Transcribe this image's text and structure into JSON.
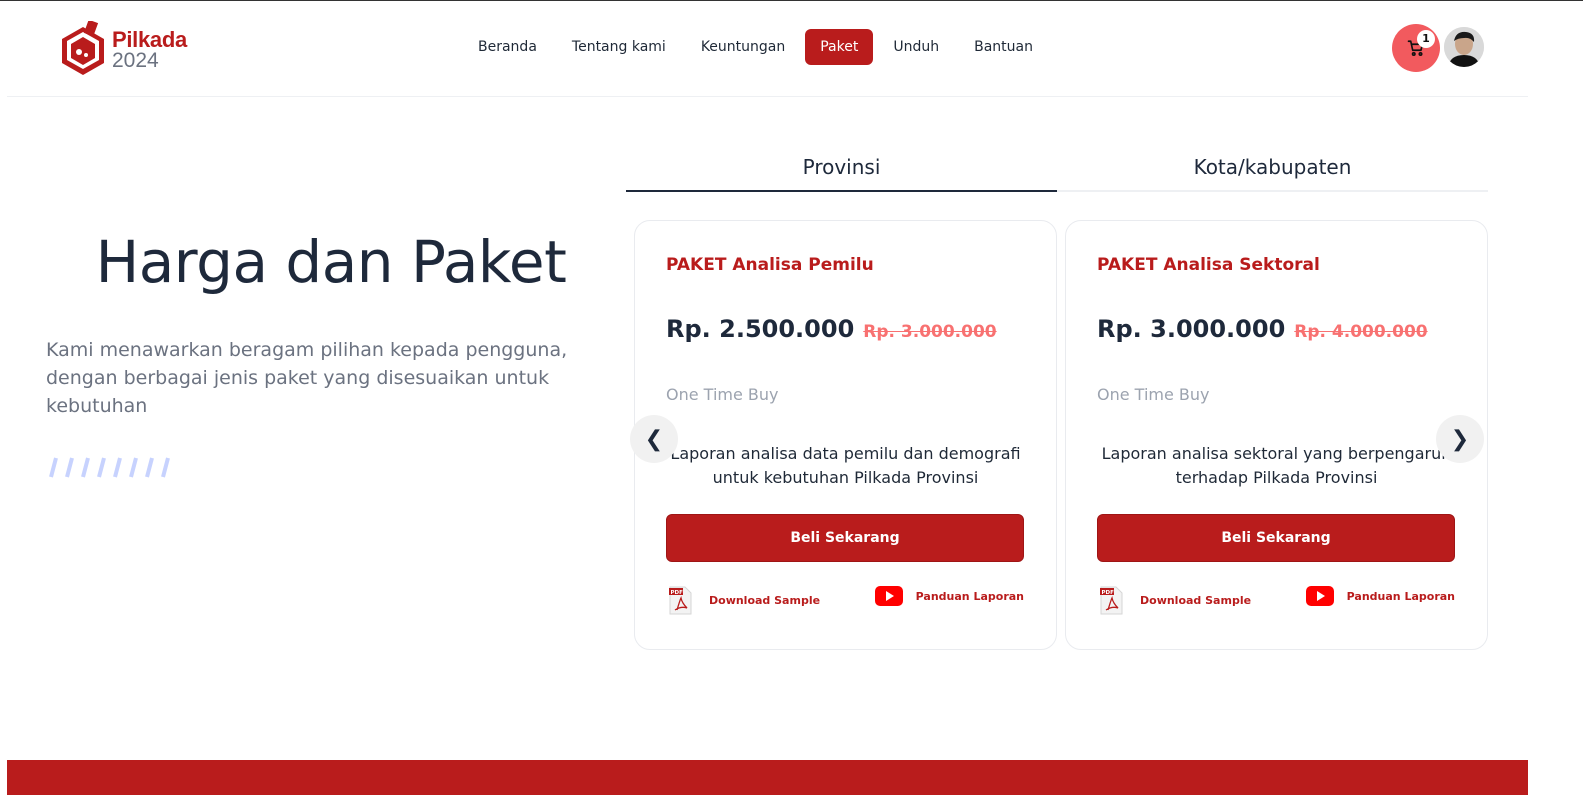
{
  "brand": {
    "name": "Pilkada",
    "year": "2024",
    "color": "#b91c1c"
  },
  "nav": {
    "items": [
      {
        "label": "Beranda"
      },
      {
        "label": "Tentang kami"
      },
      {
        "label": "Keuntungan"
      },
      {
        "label": "Paket",
        "active": true
      },
      {
        "label": "Unduh"
      },
      {
        "label": "Bantuan"
      }
    ]
  },
  "cart": {
    "count": "1",
    "icon": "cart-icon"
  },
  "hero": {
    "title": "Harga dan Paket",
    "description": "Kami menawarkan beragam pilihan kepada pengguna, dengan berbagai jenis paket yang disesuaikan untuk kebutuhan"
  },
  "tabs": [
    {
      "label": "Provinsi",
      "active": true
    },
    {
      "label": "Kota/kabupaten",
      "active": false
    }
  ],
  "carousel": {
    "prev": "❮",
    "next": "❯"
  },
  "packages": [
    {
      "title": "PAKET Analisa Pemilu",
      "price": "Rp. 2.500.000",
      "old_price": "Rp. 3.000.000",
      "buy_type": "One Time Buy",
      "description": "Laporan analisa data pemilu dan demografi untuk kebutuhan Pilkada Provinsi",
      "button": "Beli Sekarang",
      "download_label": "Download Sample",
      "guide_label": "Panduan Laporan"
    },
    {
      "title": "PAKET Analisa Sektoral",
      "price": "Rp. 3.000.000",
      "old_price": "Rp. 4.000.000",
      "buy_type": "One Time Buy",
      "description": "Laporan analisa sektoral yang berpengaruh terhadap Pilkada Provinsi",
      "button": "Beli Sekarang",
      "download_label": "Download Sample",
      "guide_label": "Panduan Laporan"
    }
  ]
}
